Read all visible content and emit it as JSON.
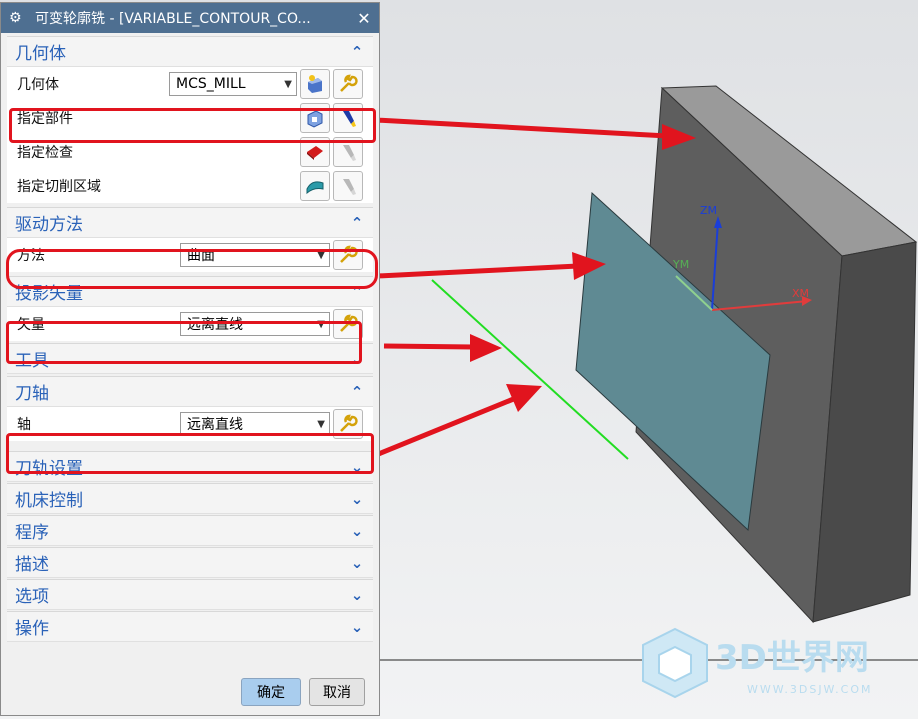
{
  "dialog": {
    "title": "可变轮廓铣 - [VARIABLE_CONTOUR_CO...",
    "close_glyph": "✕",
    "ok_label": "确定",
    "cancel_label": "取消"
  },
  "groups": {
    "geometry": {
      "header": "几何体",
      "geometry_label": "几何体",
      "geometry_value": "MCS_MILL",
      "part_label": "指定部件",
      "check_label": "指定检查",
      "cut_area_label": "指定切削区域"
    },
    "drive": {
      "header": "驱动方法",
      "method_label": "方法",
      "method_value": "曲面"
    },
    "projection": {
      "header": "投影矢量",
      "vector_label": "矢量",
      "vector_value": "远离直线"
    },
    "tool": {
      "header": "工具"
    },
    "tool_axis": {
      "header": "刀轴",
      "axis_label": "轴",
      "axis_value": "远离直线"
    },
    "collapsed": [
      "刀轨设置",
      "机床控制",
      "程序",
      "描述",
      "选项",
      "操作"
    ]
  },
  "viewport": {
    "axis_zm": "ZM",
    "axis_ym": "YM",
    "axis_xm": "XM"
  },
  "watermark": {
    "brand": "3D世界网",
    "url": "WWW.3DSJW.COM"
  },
  "colors": {
    "accent": "#2a62b8",
    "highlight": "#e1141e",
    "block": "#5e5e5e",
    "surface": "#5f8a93",
    "line": "#22dd22"
  }
}
